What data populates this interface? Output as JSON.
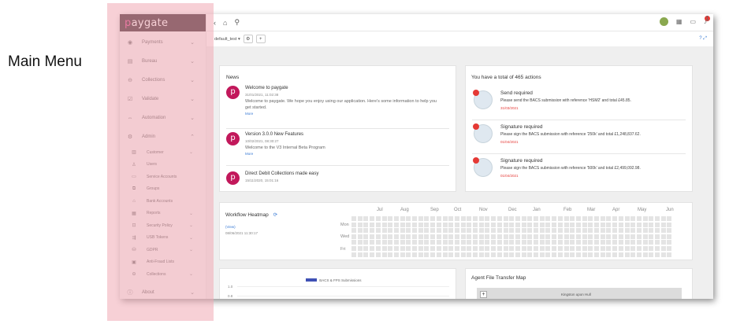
{
  "caption": "Main Menu",
  "app": {
    "brand_p": "p",
    "brand_rest": "aygate"
  },
  "sidebar": {
    "items": [
      {
        "label": "Payments",
        "icon": "eye-icon"
      },
      {
        "label": "Bureau",
        "icon": "bureau-icon"
      },
      {
        "label": "Collections",
        "icon": "collections-icon"
      },
      {
        "label": "Validate",
        "icon": "check-icon"
      },
      {
        "label": "Automation",
        "icon": "automation-icon"
      },
      {
        "label": "Admin",
        "icon": "gear-icon"
      }
    ],
    "admin_sub": [
      {
        "label": "Customer",
        "chev": true
      },
      {
        "label": "Users",
        "chev": false
      },
      {
        "label": "Service Accounts",
        "chev": false
      },
      {
        "label": "Groups",
        "chev": false
      },
      {
        "label": "Bank Accounts",
        "chev": false
      },
      {
        "label": "Reports",
        "chev": true
      },
      {
        "label": "Security Policy",
        "chev": true
      },
      {
        "label": "USB Tokens",
        "chev": true
      },
      {
        "label": "GDPR",
        "chev": true
      },
      {
        "label": "Anti-Fraud Lists",
        "chev": false
      },
      {
        "label": "Collections",
        "chev": true
      }
    ],
    "about": "About"
  },
  "topbar": {
    "notification_count": "1"
  },
  "subbar": {
    "customer_select": "default_test ▾"
  },
  "news": {
    "title": "News",
    "items": [
      {
        "title": "Welcome to paygate",
        "date": "31/01/2021, 11:02:38",
        "body": "Welcome to paygate. We hope you enjoy using our application. Here's some information to help you get started.",
        "more": "More"
      },
      {
        "title": "Version 3.0.0 New Features",
        "date": "10/02/2021, 08:30:27",
        "body": "Welcome to the V3 Internal Beta Program",
        "more": "More"
      },
      {
        "title": "Direct Debit Collections made easy",
        "date": "15/11/2020, 15:01:16",
        "body": "",
        "more": ""
      }
    ]
  },
  "actions": {
    "title": "You have a total of 465 actions",
    "items": [
      {
        "title": "Send required",
        "desc": "Please send the BACS submission with reference 'HSM2' and total £45.85.",
        "date": "31/03/2021"
      },
      {
        "title": "Signature required",
        "desc": "Please sign the BACS submission with reference '250k' and total £1,248,837.62.",
        "date": "01/04/2021"
      },
      {
        "title": "Signature required",
        "desc": "Please sign the BACS submission with reference '500k' and total £2,499,092.98.",
        "date": "01/04/2021"
      }
    ]
  },
  "heatmap": {
    "title": "Workflow Heatmap",
    "view_link": "(View)",
    "date": "08/06/2021 11:30:17",
    "months": [
      "Jul",
      "Aug",
      "Sep",
      "Oct",
      "Nov",
      "Dec",
      "Jan",
      "Feb",
      "Mar",
      "Apr",
      "May",
      "Jun"
    ],
    "days": [
      "Mon",
      "Wed",
      "Fri"
    ]
  },
  "bacs_chart": {
    "legend": "BACS & FPS Submissions",
    "y_ticks": [
      "1.0",
      "0.8"
    ]
  },
  "map": {
    "title": "Agent File Transfer Map",
    "place1": "Kingston upon Hull",
    "zoom_in": "+"
  }
}
